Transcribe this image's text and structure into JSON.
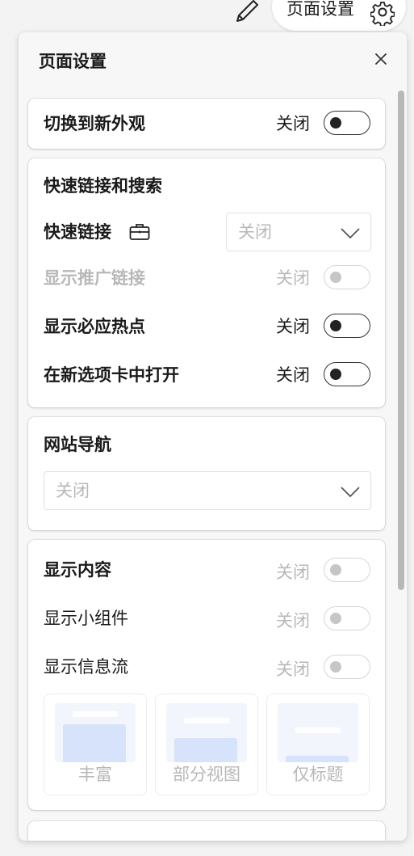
{
  "topbar": {
    "settings_button_label": "页面设置"
  },
  "panel": {
    "title": "页面设置"
  },
  "appearance": {
    "label": "切换到新外观",
    "state": "关闭"
  },
  "quicklinks": {
    "title": "快速链接和搜索",
    "quick_links": {
      "label": "快速链接",
      "value": "关闭"
    },
    "promoted_links": {
      "label": "显示推广链接",
      "state": "关闭"
    },
    "hot_topics": {
      "label": "显示必应热点",
      "state": "关闭"
    },
    "new_tab": {
      "label": "在新选项卡中打开",
      "state": "关闭"
    }
  },
  "site_nav": {
    "title": "网站导航",
    "value": "关闭"
  },
  "content": {
    "show_content": {
      "label": "显示内容",
      "state": "关闭"
    },
    "show_widgets": {
      "label": "显示小组件",
      "state": "关闭"
    },
    "show_feed": {
      "label": "显示信息流",
      "state": "关闭"
    },
    "layouts": [
      "丰富",
      "部分视图",
      "仅标题"
    ]
  },
  "colors": {
    "accent_thumb": "#d7e3fb",
    "toggle_on_border": "#333333",
    "muted_text": "#b8b8b8"
  }
}
